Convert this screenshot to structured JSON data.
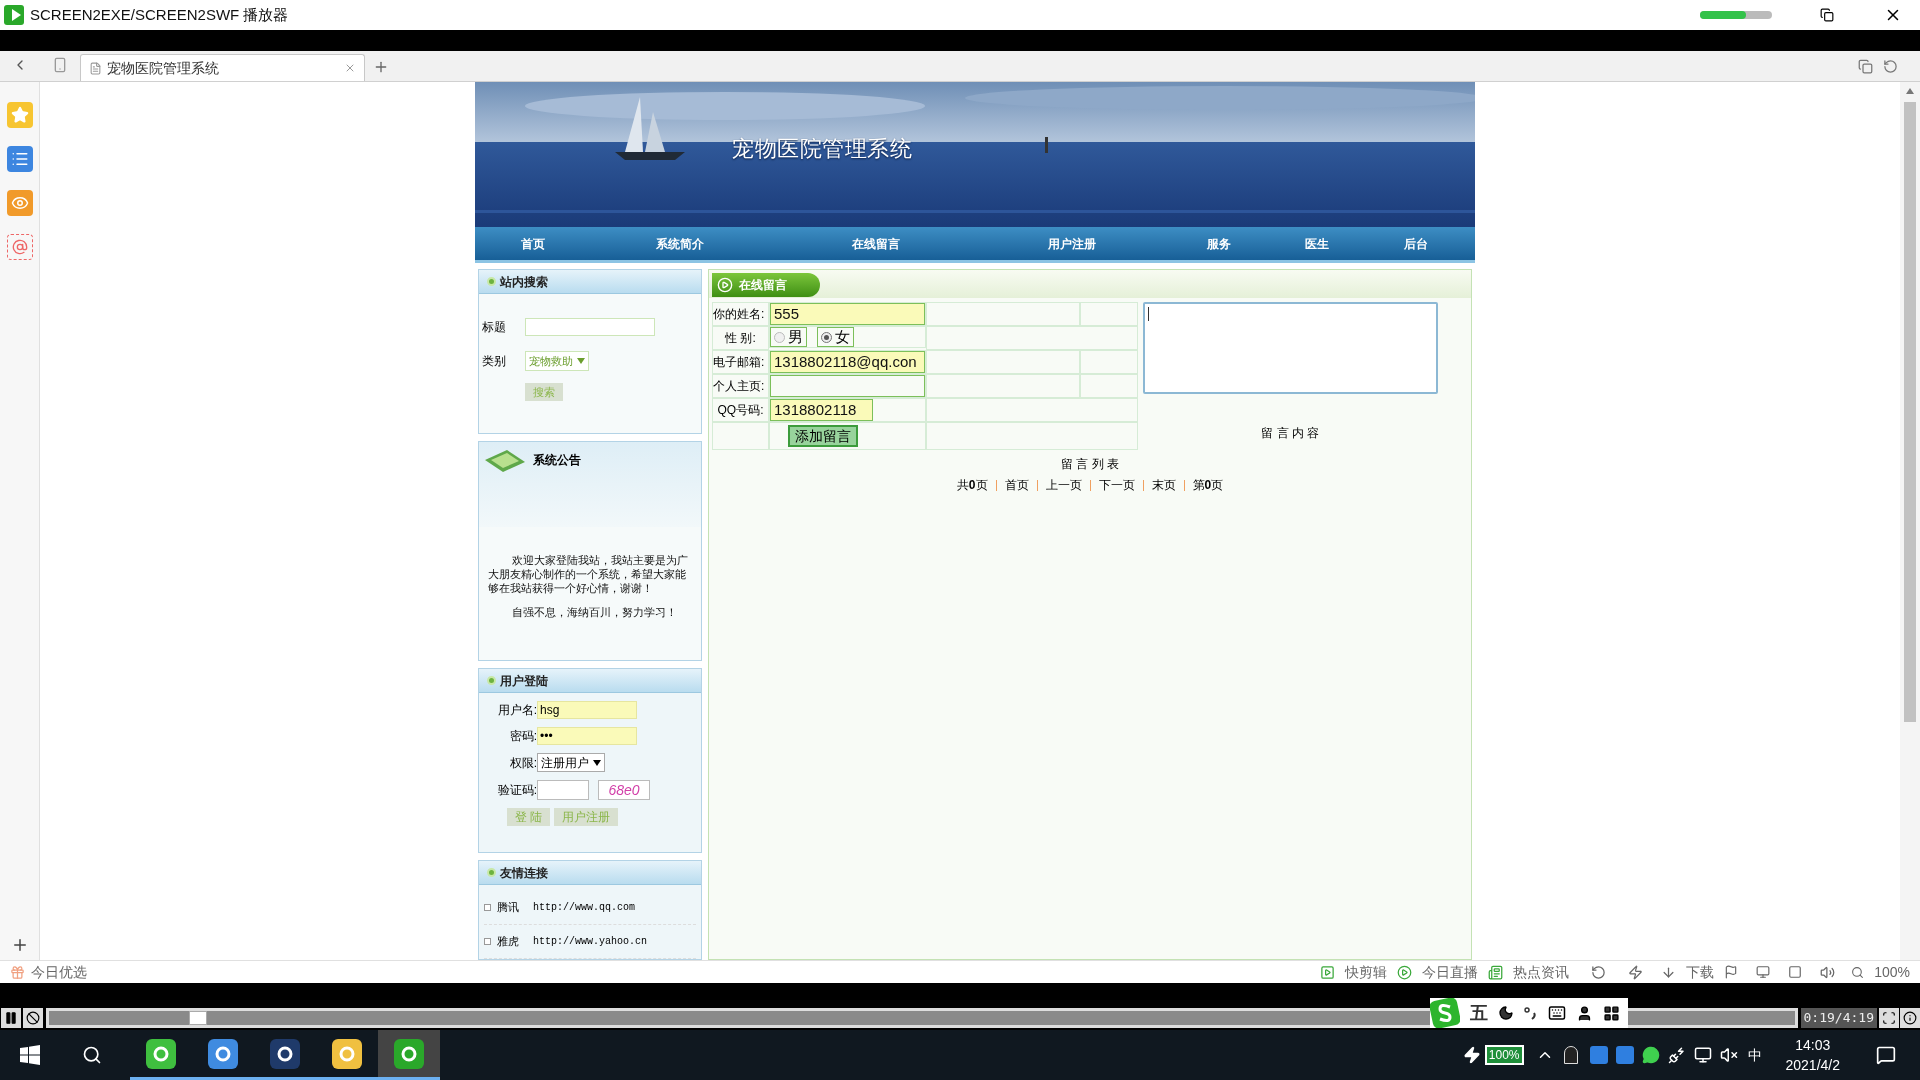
{
  "window": {
    "title": "SCREEN2EXE/SCREEN2SWF 播放器"
  },
  "browser": {
    "tabs": [
      {
        "label": "宠物医院管理系统",
        "selected": true
      }
    ]
  },
  "site": {
    "banner_title": "宠物医院管理系统",
    "nav": [
      "首页",
      "系统简介",
      "在线留言",
      "用户注册",
      "服务",
      "医生",
      "后台"
    ]
  },
  "search_panel": {
    "title": "站内搜索",
    "title_label": "标题",
    "category_label": "类别",
    "category": "宠物救助",
    "button": "搜索"
  },
  "notice": {
    "title": "系统公告",
    "paragraphs": [
      "欢迎大家登陆我站，我站主要是为广大朋友精心制作的一个系统，希望大家能够在我站获得一个好心情，谢谢！",
      "自强不息，海纳百川，努力学习！"
    ]
  },
  "login": {
    "title": "用户登陆",
    "username_label": "用户名:",
    "username": "hsg",
    "password_label": "密码:",
    "password": "•••",
    "role_label": "权限:",
    "role": "注册用户",
    "captcha_label": "验证码:",
    "captcha": "68e0",
    "buttons": [
      "登 陆",
      "用户注册"
    ]
  },
  "links": {
    "title": "友情连接",
    "items": [
      {
        "name": "腾讯",
        "url": "http://www.qq.com"
      },
      {
        "name": "雅虎",
        "url": "http://www.yahoo.cn"
      }
    ]
  },
  "message_form": {
    "title": "在线留言",
    "name_label": "你的姓名:",
    "name": "555",
    "gender_label": "性 别:",
    "genders": [
      {
        "label": "男",
        "selected": false
      },
      {
        "label": "女",
        "selected": true
      }
    ],
    "email_label": "电子邮箱:",
    "email": "1318802118@qq.con",
    "homepage_label": "个人主页:",
    "qq_label": "QQ号码:",
    "qq": "1318802118",
    "submit": "添加留言",
    "content_label": "留 言 内 容"
  },
  "message_list": {
    "title": "留 言 列 表",
    "pager": [
      "共**0**页",
      "首页",
      "上一页",
      "下一页",
      "末页",
      "第**0**页"
    ]
  },
  "status_bar": {
    "left": "今日优选",
    "items": [
      "快剪辑",
      "今日直播",
      "热点资讯",
      "下载"
    ],
    "zoom": "100%"
  },
  "player": {
    "level": 0.08,
    "time": "0:19/4:19"
  },
  "ime": {
    "mode": "五"
  },
  "taskbar": {
    "battery": "100%",
    "input_method": "中",
    "time": "14:03",
    "date": "2021/4/2"
  }
}
